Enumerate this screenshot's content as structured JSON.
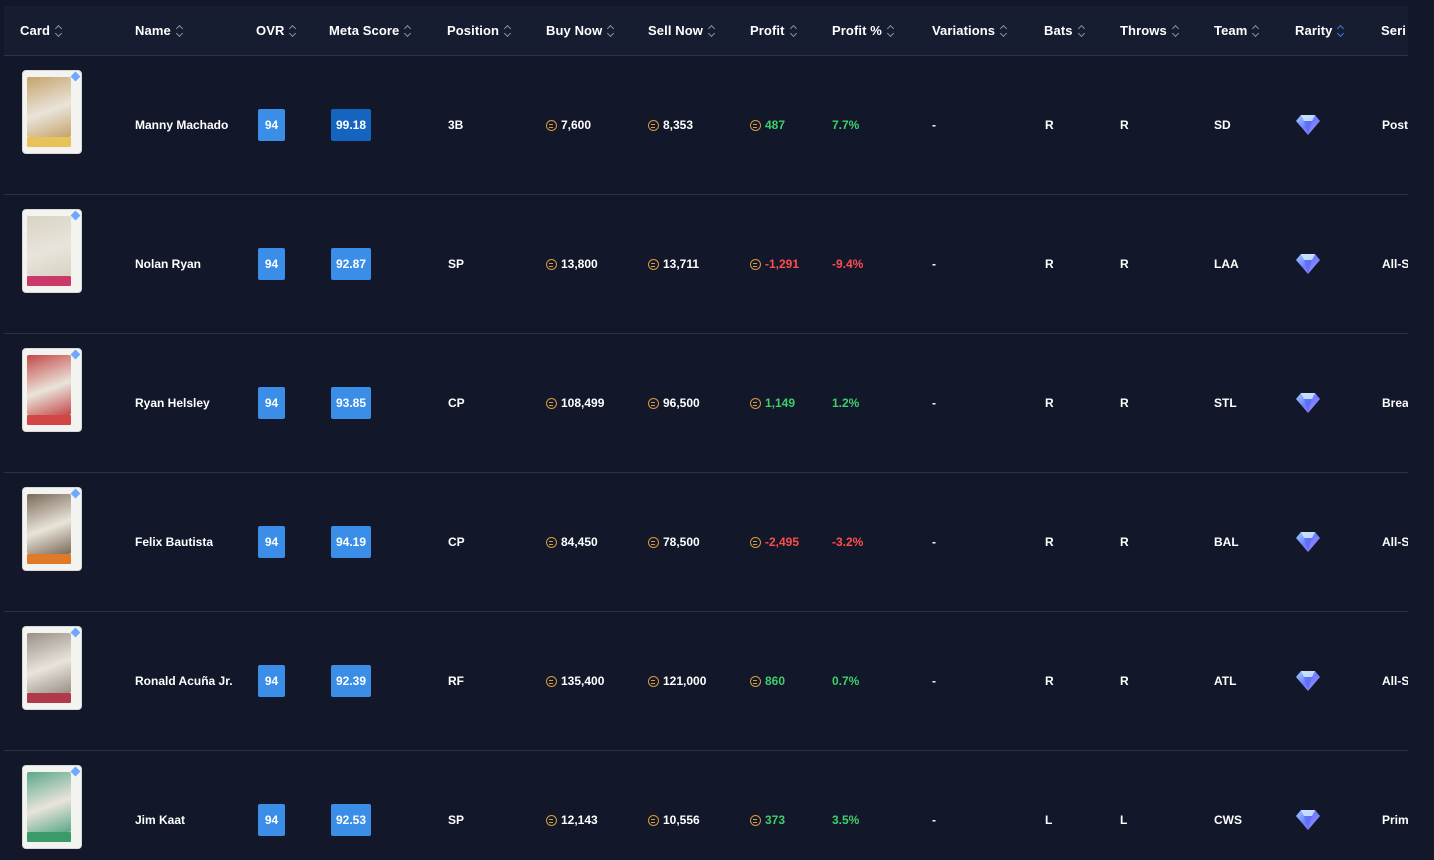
{
  "columns": [
    {
      "key": "card",
      "label": "Card"
    },
    {
      "key": "name",
      "label": "Name"
    },
    {
      "key": "ovr",
      "label": "OVR"
    },
    {
      "key": "meta",
      "label": "Meta Score"
    },
    {
      "key": "position",
      "label": "Position"
    },
    {
      "key": "buy",
      "label": "Buy Now"
    },
    {
      "key": "sell",
      "label": "Sell Now"
    },
    {
      "key": "profit",
      "label": "Profit"
    },
    {
      "key": "profit_pct",
      "label": "Profit %"
    },
    {
      "key": "variations",
      "label": "Variations"
    },
    {
      "key": "bats",
      "label": "Bats"
    },
    {
      "key": "throws",
      "label": "Throws"
    },
    {
      "key": "team",
      "label": "Team"
    },
    {
      "key": "rarity",
      "label": "Rarity"
    },
    {
      "key": "series",
      "label": "Seri"
    }
  ],
  "rows": [
    {
      "name": "Manny Machado",
      "ovr": "94",
      "meta": "99.18",
      "position": "3B",
      "buy": "7,600",
      "sell": "8,353",
      "profit": "487",
      "profit_sign": "pos",
      "profit_pct": "7.7%",
      "variations": "-",
      "bats": "R",
      "throws": "R",
      "team": "SD",
      "series": "Posts",
      "card_color": "#c6a36a",
      "band_color": "#e7c35a"
    },
    {
      "name": "Nolan Ryan",
      "ovr": "94",
      "meta": "92.87",
      "position": "SP",
      "buy": "13,800",
      "sell": "13,711",
      "profit": "-1,291",
      "profit_sign": "neg",
      "profit_pct": "-9.4%",
      "variations": "-",
      "bats": "R",
      "throws": "R",
      "team": "LAA",
      "series": "All-St",
      "card_color": "#d8d3c4",
      "band_color": "#c93a6a"
    },
    {
      "name": "Ryan Helsley",
      "ovr": "94",
      "meta": "93.85",
      "position": "CP",
      "buy": "108,499",
      "sell": "96,500",
      "profit": "1,149",
      "profit_sign": "pos",
      "profit_pct": "1.2%",
      "variations": "-",
      "bats": "R",
      "throws": "R",
      "team": "STL",
      "series": "Break",
      "card_color": "#c44848",
      "band_color": "#d24646"
    },
    {
      "name": "Felix Bautista",
      "ovr": "94",
      "meta": "94.19",
      "position": "CP",
      "buy": "84,450",
      "sell": "78,500",
      "profit": "-2,495",
      "profit_sign": "neg",
      "profit_pct": "-3.2%",
      "variations": "-",
      "bats": "R",
      "throws": "R",
      "team": "BAL",
      "series": "All-St",
      "card_color": "#7a6a58",
      "band_color": "#e07a2a"
    },
    {
      "name": "Ronald Acuña Jr.",
      "ovr": "94",
      "meta": "92.39",
      "position": "RF",
      "buy": "135,400",
      "sell": "121,000",
      "profit": "860",
      "profit_sign": "pos",
      "profit_pct": "0.7%",
      "variations": "-",
      "bats": "R",
      "throws": "R",
      "team": "ATL",
      "series": "All-St",
      "card_color": "#9a8f88",
      "band_color": "#b03a4a"
    },
    {
      "name": "Jim Kaat",
      "ovr": "94",
      "meta": "92.53",
      "position": "SP",
      "buy": "12,143",
      "sell": "10,556",
      "profit": "373",
      "profit_sign": "pos",
      "profit_pct": "3.5%",
      "variations": "-",
      "bats": "L",
      "throws": "L",
      "team": "CWS",
      "series": "Prime",
      "card_color": "#5aa88a",
      "band_color": "#3a9a6a"
    }
  ],
  "colors": {
    "background": "#12182a",
    "header": "#161d31",
    "badge": "#3a8ee8",
    "badge_top": "#1565c0",
    "positive": "#3ecf6a",
    "negative": "#ff4d4d",
    "coin": "#d79a3e"
  },
  "icons": {
    "sort": "sort-chevrons-icon",
    "coin": "stubs-coin-icon",
    "rarity": "diamond-gem-icon"
  }
}
